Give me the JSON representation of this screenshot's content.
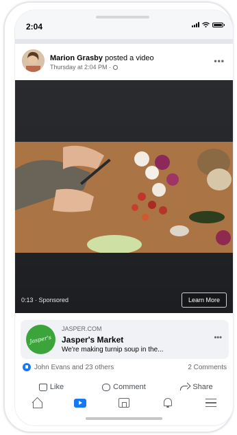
{
  "status_bar": {
    "time": "2:04",
    "icons": [
      "cellular-signal-icon",
      "wifi-icon",
      "battery-icon"
    ]
  },
  "post": {
    "author": "Marion Grasby",
    "action": " posted a video",
    "timestamp": "Thursday at 2:04 PM ·",
    "privacy_icon": "globe-icon",
    "more_icon": "more-horizontal-icon"
  },
  "video": {
    "timestamp_label": "0:13 · Sponsored",
    "cta_label": "Learn More"
  },
  "ad": {
    "domain": "JASPER.COM",
    "title": "Jasper's Market",
    "description": "We're making turnip soup in the...",
    "logo_text": "Jasper's",
    "logo_color": "#3ba53b"
  },
  "reactions": {
    "summary": "John Evans and 23 others",
    "comments": "2 Comments"
  },
  "actions": {
    "like": "Like",
    "comment": "Comment",
    "share": "Share"
  },
  "nav": {
    "items": [
      "home-icon",
      "watch-icon",
      "marketplace-icon",
      "notifications-icon",
      "menu-icon"
    ],
    "active": "watch-icon"
  },
  "colors": {
    "accent": "#1877f2",
    "muted_text": "#65676b",
    "divider": "#e4e6eb"
  }
}
